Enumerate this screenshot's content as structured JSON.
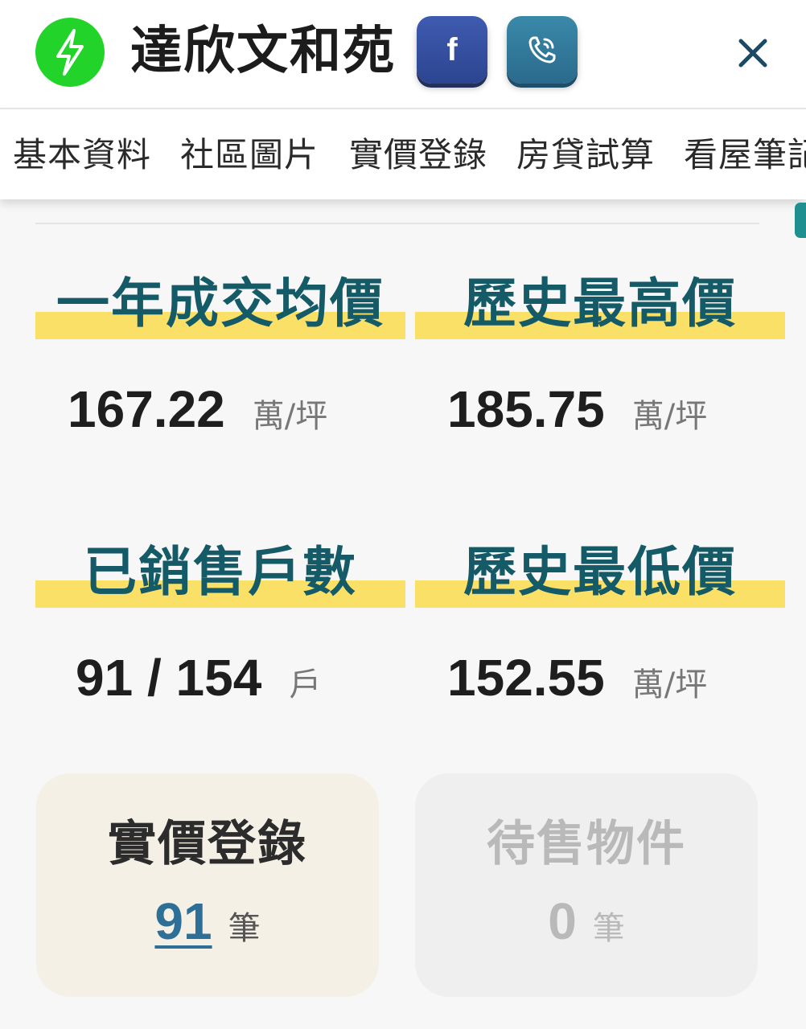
{
  "header": {
    "title": "達欣文和苑",
    "logo_icon": "lightning-bolt-icon",
    "facebook_icon": "facebook-icon",
    "facebook_glyph": "f",
    "phone_icon": "phone-call-icon",
    "close_icon": "close-icon",
    "colors": {
      "logo": "#22d42a",
      "facebook": "#34509e",
      "phone": "#2f7b9b"
    }
  },
  "tabs": [
    {
      "label": "基本資料"
    },
    {
      "label": "社區圖片"
    },
    {
      "label": "實價登錄"
    },
    {
      "label": "房貸試算"
    },
    {
      "label": "看屋筆記"
    }
  ],
  "stats": {
    "avg_price": {
      "label": "一年成交均價",
      "value": "167.22",
      "unit": "萬/坪"
    },
    "max_price": {
      "label": "歷史最高價",
      "value": "185.75",
      "unit": "萬/坪"
    },
    "sold_units": {
      "label": "已銷售戶數",
      "value": "91 / 154",
      "unit": "戶"
    },
    "min_price": {
      "label": "歷史最低價",
      "value": "152.55",
      "unit": "萬/坪"
    }
  },
  "cards": {
    "real_price": {
      "title": "實價登錄",
      "count": "91",
      "unit": "筆"
    },
    "for_sale": {
      "title": "待售物件",
      "count": "0",
      "unit": "筆"
    }
  },
  "colors": {
    "label_text": "#145a67",
    "highlight": "#fbe067",
    "accent_link": "#2e6f97"
  }
}
